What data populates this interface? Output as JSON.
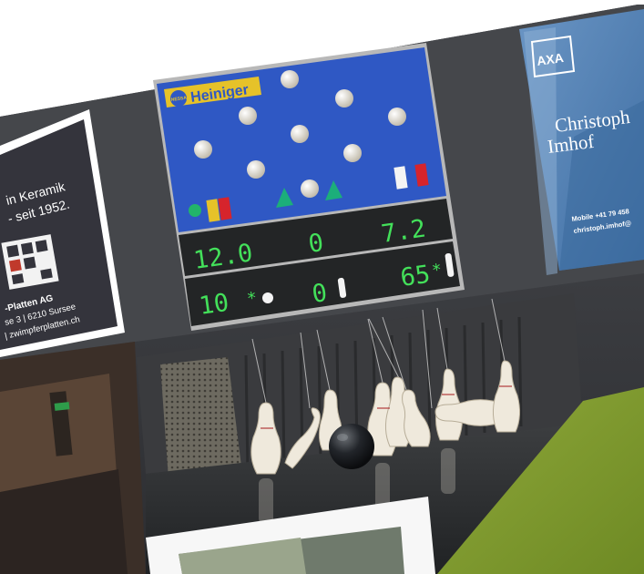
{
  "ad_left": {
    "line1": "in Keramik",
    "line2": "- seit 1952.",
    "company": "-Platten AG",
    "address": "se 3 | 6210 Sursee",
    "web": "| zwimpferplatten.ch"
  },
  "ad_right": {
    "logo": "AXA",
    "name_first": "Christoph",
    "name_last": "Imhof",
    "mobile": "Mobile +41 79 458",
    "email": "christoph.imhof@"
  },
  "scoreboard": {
    "brand_badge": "NESSA",
    "brand": "Heiniger",
    "row1": [
      "12.0",
      "0",
      "7.2"
    ],
    "row2_left": "10",
    "row2_mid": "0",
    "row2_right": "65"
  },
  "colors": {
    "board_blue": "#2f58c4",
    "led_green": "#43e05a",
    "lane_green": "#7f9a2e",
    "axa_blue": "#5b87b8"
  }
}
